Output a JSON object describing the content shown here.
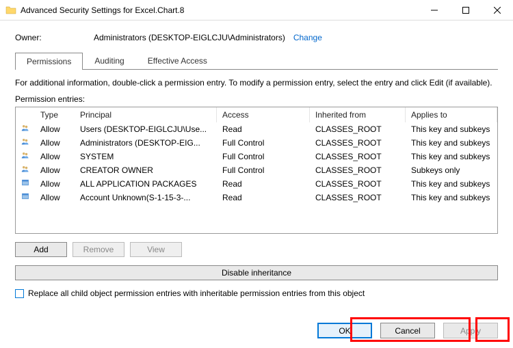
{
  "window": {
    "title": "Advanced Security Settings for Excel.Chart.8"
  },
  "owner": {
    "label": "Owner:",
    "value": "Administrators (DESKTOP-EIGLCJU\\Administrators)",
    "change": "Change"
  },
  "tabs": {
    "permissions": "Permissions",
    "auditing": "Auditing",
    "effective": "Effective Access"
  },
  "help": "For additional information, double-click a permission entry. To modify a permission entry, select the entry and click Edit (if available).",
  "entries_label": "Permission entries:",
  "columns": {
    "type": "Type",
    "principal": "Principal",
    "access": "Access",
    "inherited": "Inherited from",
    "applies": "Applies to"
  },
  "rows": [
    {
      "icon": "people",
      "type": "Allow",
      "principal": "Users (DESKTOP-EIGLCJU\\Use...",
      "access": "Read",
      "inherited": "CLASSES_ROOT",
      "applies": "This key and subkeys"
    },
    {
      "icon": "people",
      "type": "Allow",
      "principal": "Administrators (DESKTOP-EIG...",
      "access": "Full Control",
      "inherited": "CLASSES_ROOT",
      "applies": "This key and subkeys"
    },
    {
      "icon": "people",
      "type": "Allow",
      "principal": "SYSTEM",
      "access": "Full Control",
      "inherited": "CLASSES_ROOT",
      "applies": "This key and subkeys"
    },
    {
      "icon": "people",
      "type": "Allow",
      "principal": "CREATOR OWNER",
      "access": "Full Control",
      "inherited": "CLASSES_ROOT",
      "applies": "Subkeys only"
    },
    {
      "icon": "package",
      "type": "Allow",
      "principal": "ALL APPLICATION PACKAGES",
      "access": "Read",
      "inherited": "CLASSES_ROOT",
      "applies": "This key and subkeys"
    },
    {
      "icon": "package",
      "type": "Allow",
      "principal": "Account Unknown(S-1-15-3-...",
      "access": "Read",
      "inherited": "CLASSES_ROOT",
      "applies": "This key and subkeys"
    }
  ],
  "buttons": {
    "add": "Add",
    "remove": "Remove",
    "view": "View",
    "disable_inherit": "Disable inheritance",
    "replace": "Replace all child object permission entries with inheritable permission entries from this object",
    "ok": "OK",
    "cancel": "Cancel",
    "apply": "Apply"
  }
}
